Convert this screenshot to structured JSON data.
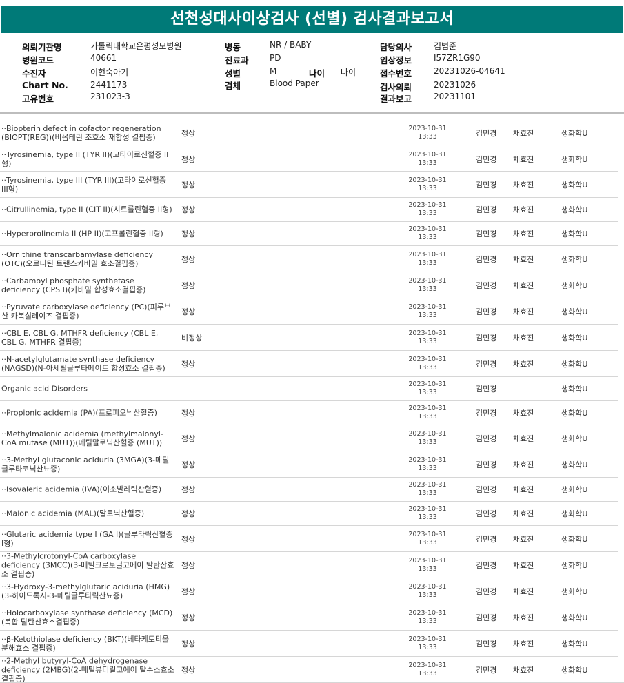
{
  "title": "선천성대사이상검사 (선별) 검사결과보고서",
  "info": {
    "institution_label": "의뢰기관명",
    "institution": "가톨릭대학교은평성모병원",
    "hospital_code_label": "병원코드",
    "hospital_code": "40661",
    "recipient_label": "수진자",
    "recipient": "이현숙아기",
    "chart_label": "Chart No.",
    "chart_no": "2441173",
    "unique_label": "고유번호",
    "unique_no": "231023-3",
    "ward_label": "병동",
    "ward": "NR / BABY",
    "dept_label": "진료과",
    "dept": "PD",
    "sex_label": "성별",
    "sex": "M",
    "age_label": "나이",
    "age": "나이",
    "specimen_label": "검체",
    "specimen": "Blood Paper",
    "doctor_label": "담당의사",
    "doctor": "김범준",
    "clinical_label": "임상정보",
    "clinical": "I57ZR1G90",
    "receipt_label": "접수번호",
    "receipt": "20231026-04641",
    "request_label": "검사의뢰",
    "request": "20231026",
    "report_label": "결과보고",
    "report": "20231101"
  },
  "rows": [
    {
      "name": "··Biopterin defect in cofactor regeneration (BIOPT(REG))(비옵테린 조효소 재합성 결핍증)",
      "result": "정상",
      "date": "2023-10-31",
      "time": "13:33",
      "c1": "김민경",
      "c2": "채효진",
      "c3": "생화학U"
    },
    {
      "name": "··Tyrosinemia, type II (TYR II)(고타이로신혈증 II형)",
      "result": "정상",
      "date": "2023-10-31",
      "time": "13:33",
      "c1": "김민경",
      "c2": "채효진",
      "c3": "생화학U"
    },
    {
      "name": "··Tyrosinemia, type III (TYR III)(고타이로신혈증 III형)",
      "result": "정상",
      "date": "2023-10-31",
      "time": "13:33",
      "c1": "김민경",
      "c2": "채효진",
      "c3": "생화학U"
    },
    {
      "name": "··Citrullinemia, type II (CIT II)(시트룰린혈증 II형)",
      "result": "정상",
      "date": "2023-10-31",
      "time": "13:33",
      "c1": "김민경",
      "c2": "채효진",
      "c3": "생화학U"
    },
    {
      "name": "··Hyperprolinemia II (HP II)(고프롤린혈증 II형)",
      "result": "정상",
      "date": "2023-10-31",
      "time": "13:33",
      "c1": "김민경",
      "c2": "채효진",
      "c3": "생화학U"
    },
    {
      "name": "··Ornithine transcarbamylase deficiency (OTC)(오르니틴 트랜스카바밀 효소결핍증)",
      "result": "정상",
      "date": "2023-10-31",
      "time": "13:33",
      "c1": "김민경",
      "c2": "채효진",
      "c3": "생화학U"
    },
    {
      "name": "··Carbamoyl phosphate synthetase deficiency (CPS I)(카바밀 합성효소결핍증)",
      "result": "정상",
      "date": "2023-10-31",
      "time": "13:33",
      "c1": "김민경",
      "c2": "채효진",
      "c3": "생화학U"
    },
    {
      "name": "··Pyruvate carboxylase deficiency (PC)(피루브산 카복실레이즈 결핍증)",
      "result": "정상",
      "date": "2023-10-31",
      "time": "13:33",
      "c1": "김민경",
      "c2": "채효진",
      "c3": "생화학U"
    },
    {
      "name": "··CBL E, CBL G, MTHFR deficiency (CBL E, CBL G, MTHFR 결핍증)",
      "result": "비정상",
      "date": "2023-10-31",
      "time": "13:33",
      "c1": "김민경",
      "c2": "채효진",
      "c3": "생화학U"
    },
    {
      "name": "··N-acetylglutamate synthase deficiency (NAGSD)(N-아세틸글루타메이트 합성효소 결핍증)",
      "result": "정상",
      "date": "2023-10-31",
      "time": "13:33",
      "c1": "김민경",
      "c2": "채효진",
      "c3": "생화학U"
    },
    {
      "name": "Organic acid Disorders",
      "result": "",
      "date": "2023-10-31",
      "time": "13:33",
      "c1": "김민경",
      "c2": "",
      "c3": "생화학U"
    },
    {
      "name": "··Propionic acidemia (PA)(프로피오닉산혈증)",
      "result": "정상",
      "date": "2023-10-31",
      "time": "13:33",
      "c1": "김민경",
      "c2": "채효진",
      "c3": "생화학U"
    },
    {
      "name": "··Methylmalonic acidemia (methylmalonyl-CoA mutase (MUT))(메틸말로닉산혈증 (MUT))",
      "result": "정상",
      "date": "2023-10-31",
      "time": "13:33",
      "c1": "김민경",
      "c2": "채효진",
      "c3": "생화학U"
    },
    {
      "name": "··3-Methyl glutaconic aciduria (3MGA)(3-메틸글루타코닉산뇨증)",
      "result": "정상",
      "date": "2023-10-31",
      "time": "13:33",
      "c1": "김민경",
      "c2": "채효진",
      "c3": "생화학U"
    },
    {
      "name": "··Isovaleric acidemia (IVA)(이소발레릭산혈증)",
      "result": "정상",
      "date": "2023-10-31",
      "time": "13:33",
      "c1": "김민경",
      "c2": "채효진",
      "c3": "생화학U"
    },
    {
      "name": "··Malonic acidemia (MAL)(말로닉산혈증)",
      "result": "정상",
      "date": "2023-10-31",
      "time": "13:33",
      "c1": "김민경",
      "c2": "채효진",
      "c3": "생화학U"
    },
    {
      "name": "··Glutaric acidemia type I (GA I)(글루타릭산혈증 I형)",
      "result": "정상",
      "date": "2023-10-31",
      "time": "13:33",
      "c1": "김민경",
      "c2": "채효진",
      "c3": "생화학U"
    },
    {
      "name": "··3-Methylcrotonyl-CoA carboxylase deficiency (3MCC)(3-메틸크로토닐코에이 탈탄산효소 결핍증)",
      "result": "정상",
      "date": "2023-10-31",
      "time": "13:33",
      "c1": "김민경",
      "c2": "채효진",
      "c3": "생화학U"
    },
    {
      "name": "··3-Hydroxy-3-methylglutaric aciduria (HMG)(3-하이드록시-3-메틸글루타릭산뇨증)",
      "result": "정상",
      "date": "2023-10-31",
      "time": "13:33",
      "c1": "김민경",
      "c2": "채효진",
      "c3": "생화학U"
    },
    {
      "name": "··Holocarboxylase synthase deficiency (MCD)(복합 탈탄산효소결핍증)",
      "result": "정상",
      "date": "2023-10-31",
      "time": "13:33",
      "c1": "김민경",
      "c2": "채효진",
      "c3": "생화학U"
    },
    {
      "name": "··β-Ketothiolase deficiency (BKT)(베타케토티올 분해효소 결핍증)",
      "result": "정상",
      "date": "2023-10-31",
      "time": "13:33",
      "c1": "김민경",
      "c2": "채효진",
      "c3": "생화학U"
    },
    {
      "name": "··2-Methyl butyryl-CoA dehydrogenase deficiency (2MBG)(2-메틸뷰티릴코에이 탈수소효소 결핍증)",
      "result": "정상",
      "date": "2023-10-31",
      "time": "13:33",
      "c1": "김민경",
      "c2": "채효진",
      "c3": "생화학U"
    }
  ]
}
